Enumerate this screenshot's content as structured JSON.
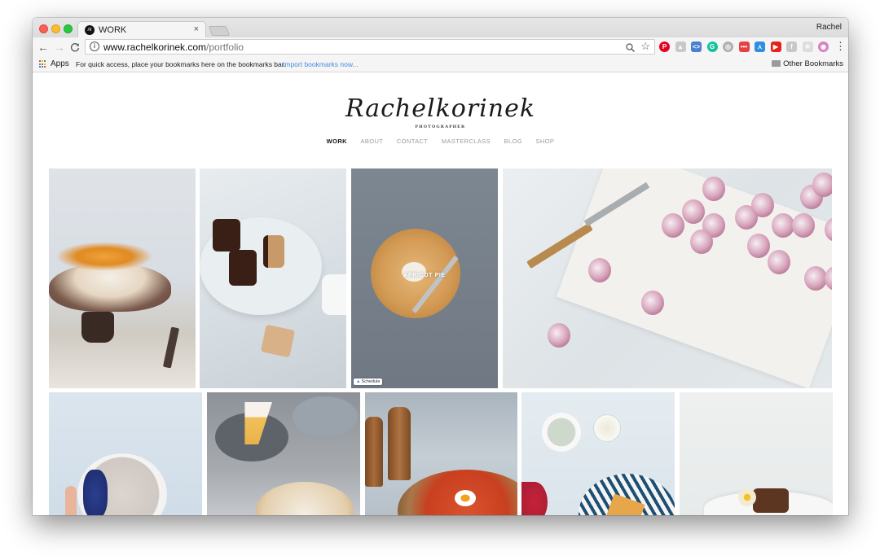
{
  "browser": {
    "tab_title": "WORK",
    "tab_favicon": "rk",
    "tab_close": "×",
    "profile_name": "Rachel",
    "url_host": "www.rachelkorinek.com",
    "url_path": "/portfolio",
    "info_icon": "i",
    "nav": {
      "back": "←",
      "forward": "→",
      "reload": "C"
    },
    "extensions": [
      {
        "name": "pinterest",
        "glyph": "P",
        "color": "#e60023"
      },
      {
        "name": "google-drive",
        "glyph": "▲",
        "color": "#c8c8c8"
      },
      {
        "name": "code-extension",
        "glyph": "<>",
        "color": "#4a7fcf"
      },
      {
        "name": "grammarly",
        "glyph": "G",
        "color": "#15c39a"
      },
      {
        "name": "gray-circle-extension",
        "glyph": "◎",
        "color": "#b0b0b0"
      },
      {
        "name": "red-bar-extension",
        "glyph": "•••",
        "color": "#e54141"
      },
      {
        "name": "swift-bird-extension",
        "glyph": "⋏",
        "color": "#2f8ee0"
      },
      {
        "name": "youtube-extension",
        "glyph": "▶",
        "color": "#e62117"
      },
      {
        "name": "facebook-extension",
        "glyph": "f",
        "color": "#c8c8c8"
      },
      {
        "name": "loading-extension",
        "glyph": "✳",
        "color": "#dddddd"
      },
      {
        "name": "instagram-extension",
        "glyph": "◉",
        "color": "#d77fc6"
      }
    ],
    "menu_glyph": "⋮"
  },
  "bookmarks_bar": {
    "apps_label": "Apps",
    "hint": "For quick access, place your bookmarks here on the bookmarks bar.",
    "import_link": "Import bookmarks now...",
    "other_bookmarks": "Other Bookmarks"
  },
  "site": {
    "logo": "Rachelkorinek",
    "logo_subtitle": "PHOTOGRAPHER",
    "nav": [
      {
        "label": "WORK",
        "active": true
      },
      {
        "label": "ABOUT",
        "active": false
      },
      {
        "label": "CONTACT",
        "active": false
      },
      {
        "label": "MASTERCLASS",
        "active": false
      },
      {
        "label": "BLOG",
        "active": false
      },
      {
        "label": "SHOP",
        "active": false
      }
    ],
    "portfolio": [
      {
        "subject": "pear-pavlova"
      },
      {
        "subject": "caneles-with-tea"
      },
      {
        "subject": "apricot-pie",
        "caption": "APRICOT PIE",
        "badge": "Schedule"
      },
      {
        "subject": "garlic-on-marble"
      },
      {
        "subject": "smoothie-bowl"
      },
      {
        "subject": "lemon-meringue-pie"
      },
      {
        "subject": "shakshuka"
      },
      {
        "subject": "raspberries-and-pie"
      },
      {
        "subject": "chocolate-cake-with-flowers"
      }
    ]
  }
}
